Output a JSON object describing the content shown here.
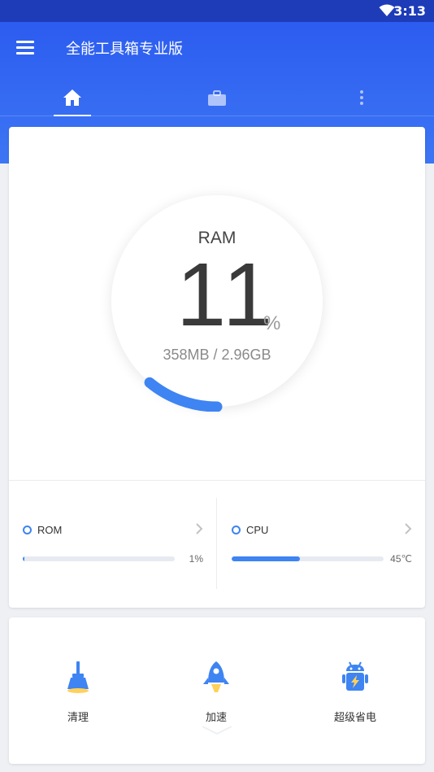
{
  "status_bar": {
    "time": "3:13",
    "wifi_icon": "wifi-icon"
  },
  "app": {
    "title": "全能工具箱专业版",
    "menu_icon": "menu-icon"
  },
  "tabs": [
    {
      "icon": "home-icon",
      "active": true
    },
    {
      "icon": "briefcase-icon",
      "active": false
    },
    {
      "icon": "more-vertical-icon",
      "active": false
    }
  ],
  "ram": {
    "label": "RAM",
    "percent": "11",
    "unit": "%",
    "usage": "358MB / 2.96GB",
    "fill_fraction": 0.11
  },
  "metrics": {
    "rom": {
      "label": "ROM",
      "value": "1%",
      "fill_fraction": 0.01
    },
    "cpu": {
      "label": "CPU",
      "value": "45℃",
      "fill_fraction": 0.45
    }
  },
  "actions": [
    {
      "label": "清理",
      "icon": "broom-icon"
    },
    {
      "label": "加速",
      "icon": "rocket-icon"
    },
    {
      "label": "超级省电",
      "icon": "android-battery-icon"
    }
  ],
  "colors": {
    "header_top": "#2c5cf0",
    "header_bottom": "#3d76f4",
    "accent": "#3e84f2",
    "status_bar": "#1e3bb8"
  }
}
